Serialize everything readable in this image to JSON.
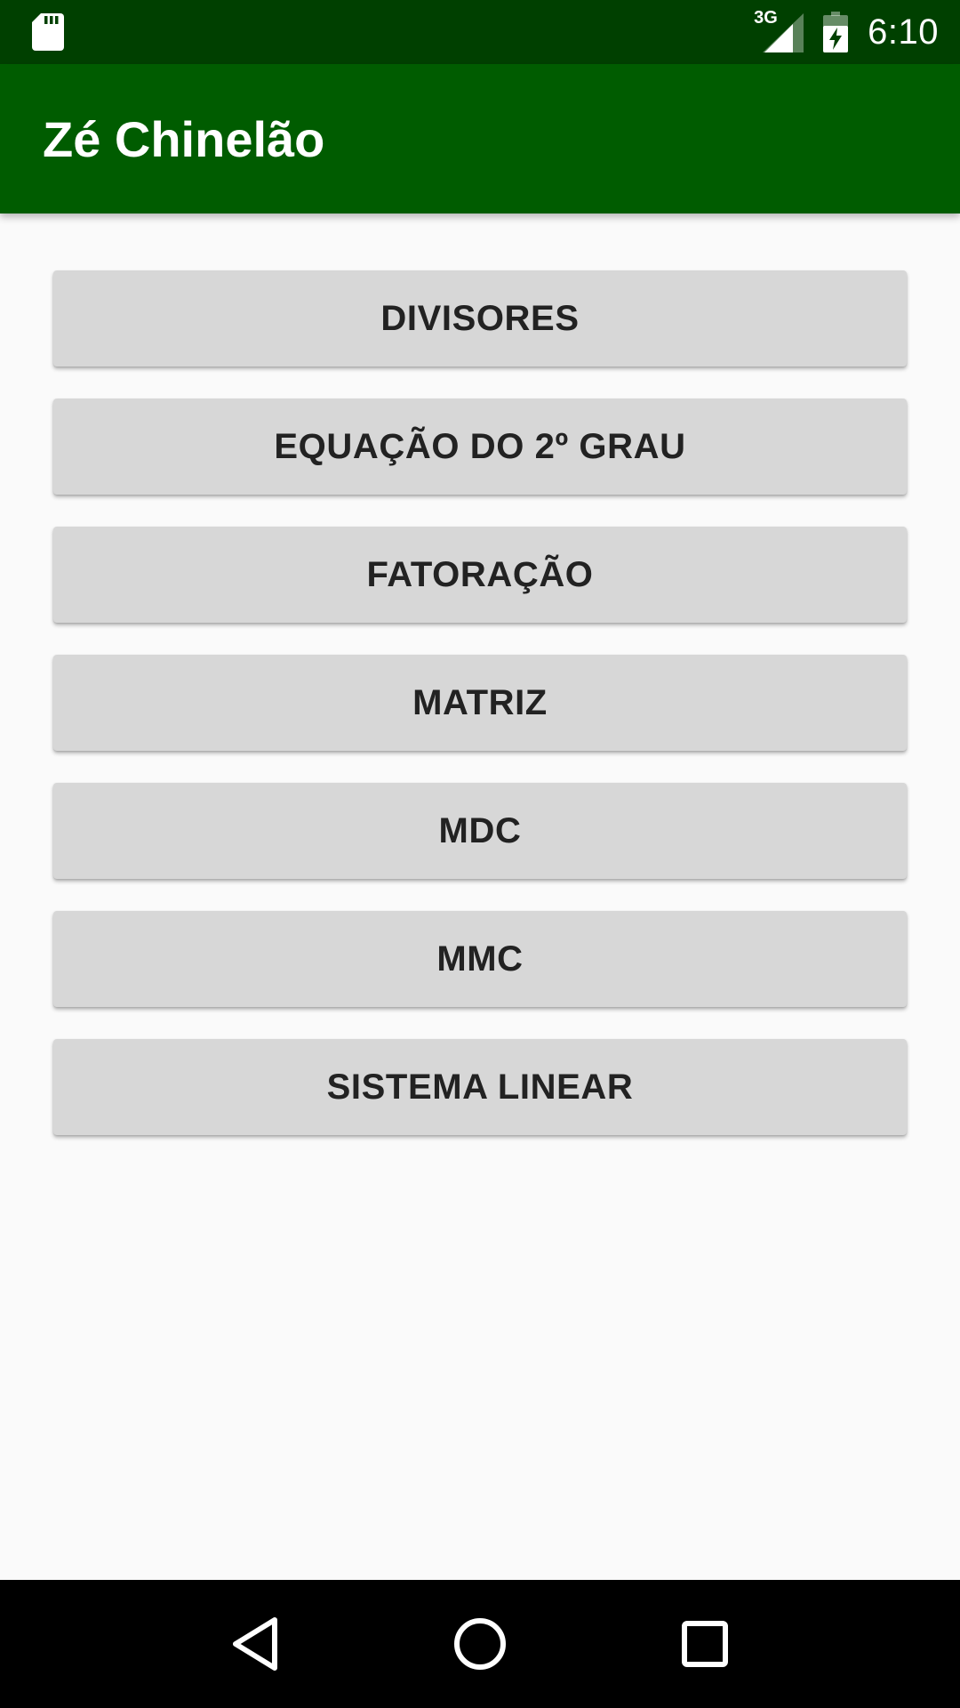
{
  "status_bar": {
    "network_type": "3G",
    "time": "6:10",
    "icons": [
      "sd-card-icon",
      "cell-signal-icon",
      "battery-charging-icon"
    ],
    "background_color": "#004000"
  },
  "app_bar": {
    "title": "Zé Chinelão",
    "background_color": "#005c00"
  },
  "menu": {
    "buttons": [
      {
        "label": "DIVISORES"
      },
      {
        "label": "EQUAÇÃO DO 2º GRAU"
      },
      {
        "label": "FATORAÇÃO"
      },
      {
        "label": "MATRIZ"
      },
      {
        "label": "MDC"
      },
      {
        "label": "MMC"
      },
      {
        "label": "SISTEMA LINEAR"
      }
    ],
    "button_color": "#d7d7d7",
    "text_color": "#222222"
  },
  "nav_bar": {
    "icons": [
      "back-icon",
      "home-icon",
      "recents-icon"
    ]
  }
}
